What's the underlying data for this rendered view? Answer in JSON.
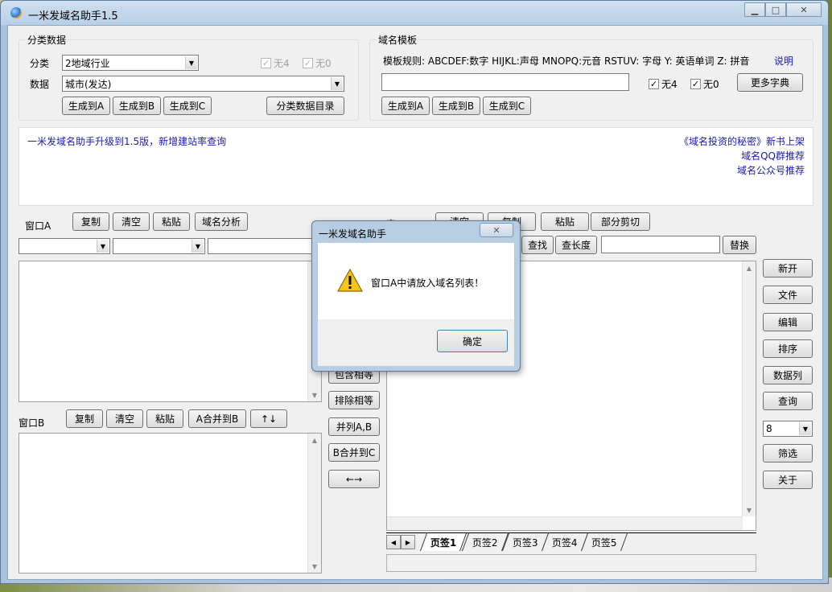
{
  "window": {
    "title": "一米发域名助手1.5"
  },
  "category": {
    "group_title": "分类数据",
    "category_label": "分类",
    "category_value": "2地域行业",
    "data_label": "数据",
    "data_value": "城市(发达)",
    "no4_label": "无4",
    "no0_label": "无0",
    "gen_a": "生成到A",
    "gen_b": "生成到B",
    "gen_c": "生成到C",
    "dir_button": "分类数据目录"
  },
  "template": {
    "group_title": "域名模板",
    "rules_text": "模板规则: ABCDEF:数字 HIJKL:声母 MNOPQ:元音 RSTUV: 字母 Y: 英语单词 Z: 拼音",
    "help_link": "说明",
    "input_value": "",
    "no4_label": "无4",
    "no4_checked": true,
    "no0_label": "无0",
    "no0_checked": true,
    "more_dict": "更多字典",
    "gen_a": "生成到A",
    "gen_b": "生成到B",
    "gen_c": "生成到C"
  },
  "notice": {
    "left": "一米发域名助手升级到1.5版，新增建站率查询",
    "right_lines": [
      "《域名投资的秘密》新书上架",
      "域名QQ群推荐",
      "域名公众号推荐"
    ]
  },
  "window_a": {
    "label": "窗口A",
    "copy": "复制",
    "clear": "清空",
    "paste": "粘贴",
    "analyze": "域名分析"
  },
  "window_b": {
    "label": "窗口B",
    "copy": "复制",
    "clear": "清空",
    "paste": "粘贴",
    "merge": "A合并到B",
    "updown": "↑↓"
  },
  "window_c": {
    "label": "窗口C",
    "clear": "清空",
    "copy": "复制",
    "paste": "粘贴",
    "partial_cut": "部分剪切",
    "find": "查找",
    "find_len": "查长度",
    "replace": "替换"
  },
  "middle": {
    "contains_equal": "包含相等",
    "exclude_equal": "排除相等",
    "parallel_ab": "并列A,B",
    "merge_b_c": "B合并到C",
    "swap": "←→"
  },
  "right_panel": {
    "new": "新开",
    "file": "文件",
    "edit": "编辑",
    "sort": "排序",
    "data_col": "数据列",
    "query": "查询",
    "select_value": "8",
    "filter": "筛选",
    "about": "关于"
  },
  "tabs": [
    "页签1",
    "页签2",
    "页签3",
    "页签4",
    "页签5"
  ],
  "dialog": {
    "title": "一米发域名助手",
    "message": "窗口A中请放入域名列表！",
    "ok": "确定"
  }
}
